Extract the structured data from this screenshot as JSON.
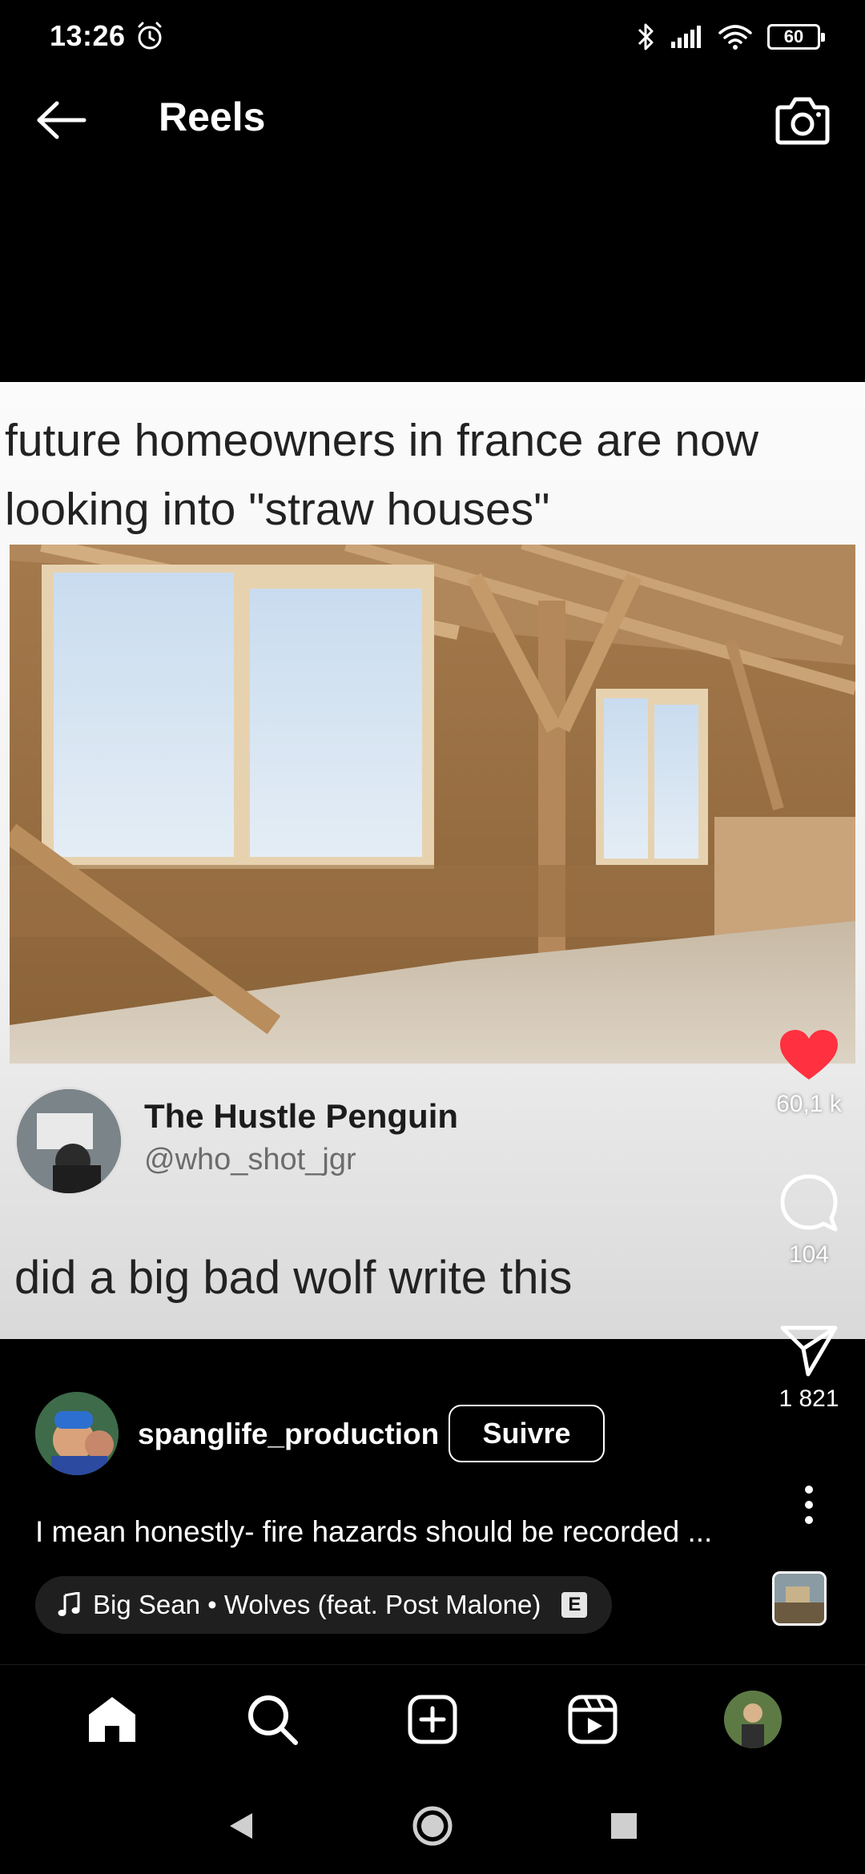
{
  "status_bar": {
    "time": "13:26",
    "battery": "60"
  },
  "header": {
    "title": "Reels"
  },
  "post": {
    "caption_image_text": "future homeowners in france are now looking into \"straw houses\"",
    "tweet_name": "The Hustle Penguin",
    "tweet_handle": "@who_shot_jgr",
    "tweet_text": "did a big bad wolf write this"
  },
  "actions": {
    "likes": "60,1 k",
    "comments": "104",
    "shares": "1 821"
  },
  "reel": {
    "author": "spanglife_production",
    "follow_label": "Suivre",
    "caption": "I mean honestly- fire hazards should be recorded ...",
    "music": "Big Sean • Wolves (feat. Post Malone)",
    "explicit_badge": "E"
  },
  "icons": {
    "back": "arrow-left-icon",
    "camera": "camera-icon",
    "like": "heart-icon",
    "comment": "comment-icon",
    "share": "send-icon",
    "more": "more-vertical-icon",
    "music": "music-note-icon",
    "home": "home-icon",
    "search": "search-icon",
    "create": "add-square-icon",
    "reels": "reels-icon"
  },
  "colors": {
    "like": "#ff3040",
    "background": "#000000"
  }
}
